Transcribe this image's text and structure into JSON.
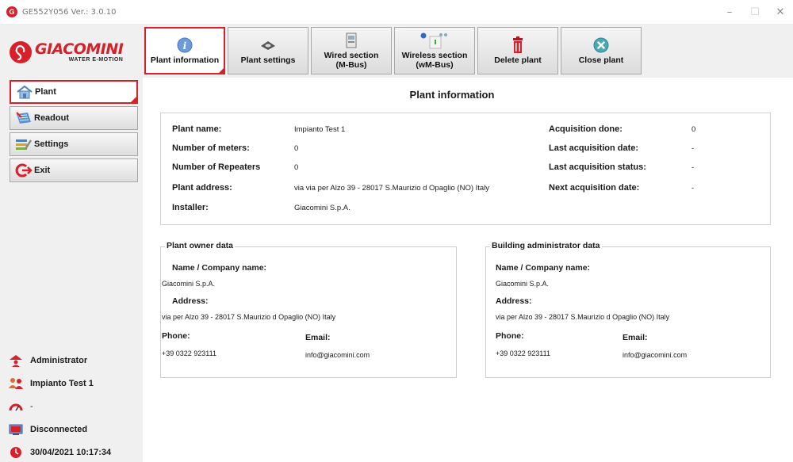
{
  "window": {
    "title": "GE552Y056 Ver.: 3.0.10",
    "controls": {
      "minimize": "–",
      "maximize": "☐",
      "close": "✕"
    }
  },
  "logo": {
    "name": "GIACOMINI",
    "tagline": "WATER E-MOTION"
  },
  "toolbar": {
    "buttons": [
      {
        "label": "Plant information",
        "icon": "info-icon",
        "active": true
      },
      {
        "label": "Plant settings",
        "icon": "settings-disc-icon",
        "active": false
      },
      {
        "label": "Wired section\n(M-Bus)",
        "icon": "wired-meter-icon",
        "active": false
      },
      {
        "label": "Wireless section\n(wM-Bus)",
        "icon": "wireless-meter-icon",
        "active": false
      },
      {
        "label": "Delete plant",
        "icon": "trash-icon",
        "active": false
      },
      {
        "label": "Close plant",
        "icon": "close-circle-icon",
        "active": false
      }
    ]
  },
  "sidebar": {
    "items": [
      {
        "label": "Plant",
        "icon": "house-icon",
        "active": true
      },
      {
        "label": "Readout",
        "icon": "readout-icon",
        "active": false
      },
      {
        "label": "Settings",
        "icon": "settings-icon",
        "active": false
      },
      {
        "label": "Exit",
        "icon": "exit-icon",
        "active": false
      }
    ],
    "status": {
      "user": "Administrator",
      "plant": "Impianto Test 1",
      "signal": "-",
      "connection": "Disconnected",
      "datetime": "30/04/2021 10:17:34"
    }
  },
  "main": {
    "title": "Plant information",
    "info": {
      "plant_name_label": "Plant name:",
      "plant_name": "Impianto Test 1",
      "meters_label": "Number of meters:",
      "meters": "0",
      "repeaters_label": "Number of Repeaters",
      "repeaters": "0",
      "address_label": "Plant address:",
      "address": "via via per Alzo 39 - 28017 S.Maurizio d Opaglio (NO) Italy",
      "installer_label": "Installer:",
      "installer": "Giacomini S.p.A.",
      "acq_done_label": "Acquisition done:",
      "acq_done": "0",
      "last_acq_date_label": "Last acquisition date:",
      "last_acq_date": "-",
      "last_acq_status_label": "Last acquisition status:",
      "last_acq_status": "-",
      "next_acq_date_label": "Next acquisition date:",
      "next_acq_date": "-"
    },
    "owner": {
      "legend": "Plant owner data",
      "name_label": "Name / Company name:",
      "name": "Giacomini S.p.A.",
      "address_label": "Address:",
      "address": "via per Alzo 39 - 28017 S.Maurizio d Opaglio (NO) Italy",
      "phone_label": "Phone:",
      "phone": "+39 0322 923111",
      "email_label": "Email:",
      "email": "info@giacomini.com"
    },
    "admin": {
      "legend": "Building administrator data",
      "name_label": "Name / Company name:",
      "name": "Giacomini S.p.A.",
      "address_label": "Address:",
      "address": "via per Alzo 39 - 28017 S.Maurizio d Opaglio (NO) Italy",
      "phone_label": "Phone:",
      "phone": "+39 0322 923111",
      "email_label": "Email:",
      "email": "info@giacomini.com"
    }
  },
  "colors": {
    "brand": "#d8202a",
    "info_blue": "#5a8fd0",
    "close_teal": "#3b9aa8"
  }
}
